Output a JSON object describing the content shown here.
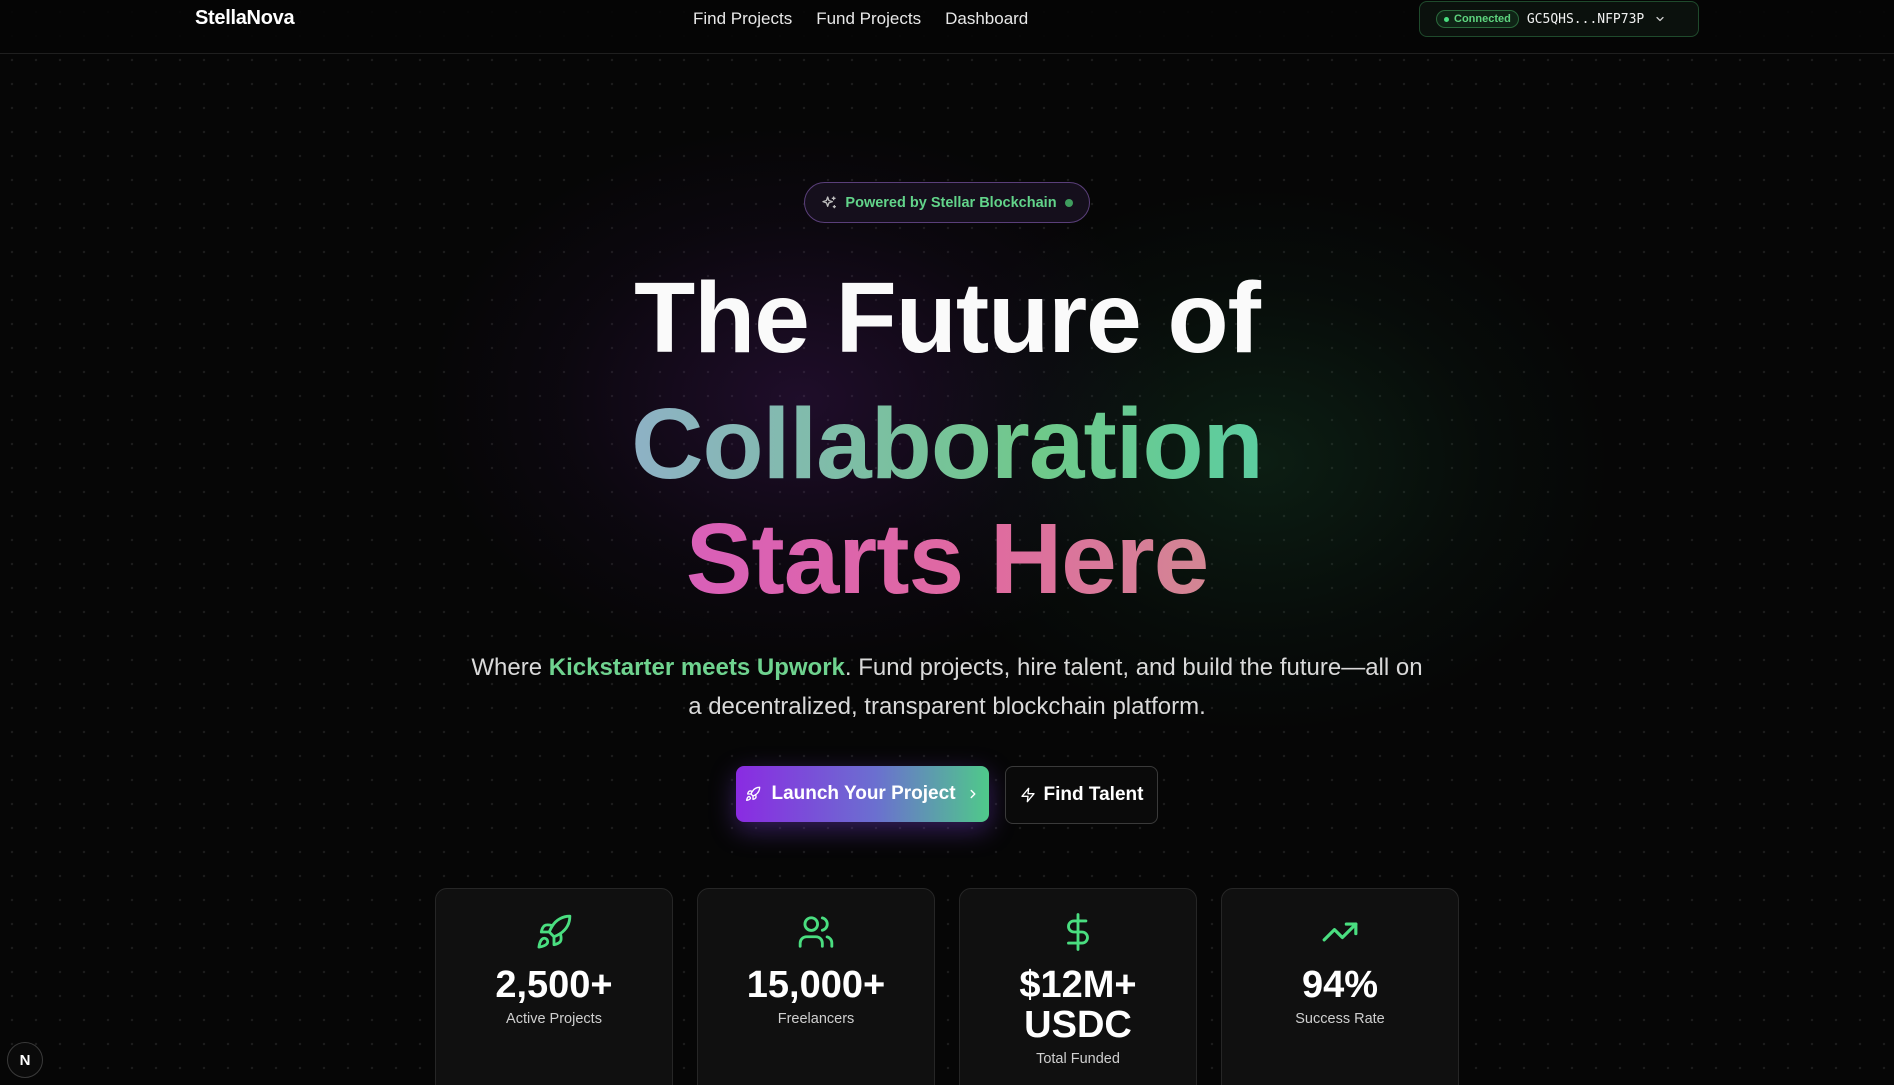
{
  "nav": {
    "logo": "StellaNova",
    "links": [
      "Find Projects",
      "Fund Projects",
      "Dashboard"
    ],
    "wallet": {
      "status": "Connected",
      "address": "GC5QHS...NFP73P"
    }
  },
  "hero": {
    "badge": "Powered by Stellar Blockchain",
    "line1": "The Future of",
    "line2": "Collaboration",
    "line3a": "Starts",
    "line3b": "Here",
    "sub_pre": "Where ",
    "sub_hl": "Kickstarter meets Upwork",
    "sub_post": ". Fund projects, hire talent, and build the future—all on a decentralized, transparent blockchain platform.",
    "cta_primary": "Launch Your Project",
    "cta_secondary": "Find Talent"
  },
  "stats": [
    {
      "icon": "rocket-icon",
      "value": "2,500+",
      "label": "Active Projects"
    },
    {
      "icon": "users-icon",
      "value": "15,000+",
      "label": "Freelancers"
    },
    {
      "icon": "dollar-icon",
      "value": "$12M+ USDC",
      "label": "Total Funded"
    },
    {
      "icon": "trending-up-icon",
      "value": "94%",
      "label": "Success Rate"
    }
  ],
  "corner_badge": "N",
  "colors": {
    "accent_green": "#4ade80",
    "accent_purple": "#8a2be2",
    "background": "#060606"
  }
}
